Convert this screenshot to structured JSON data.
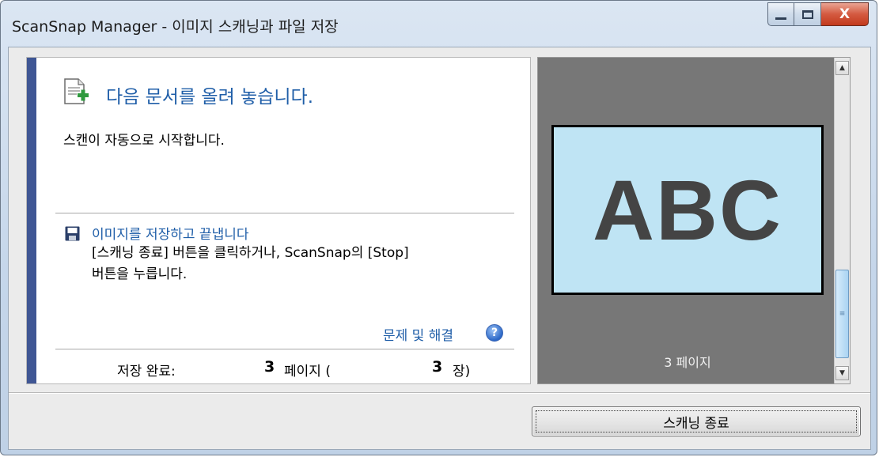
{
  "window": {
    "title": "ScanSnap Manager - 이미지 스캐닝과 파일 저장",
    "minimize_icon": "minimize-icon",
    "maximize_icon": "maximize-icon",
    "close_label": "X"
  },
  "main": {
    "heading": "다음 문서를 올려 놓습니다.",
    "subtitle": "스캔이 자동으로 시작합니다.",
    "save_link": "이미지를 저장하고 끝냅니다",
    "save_desc_line1": "[스캐닝 종료] 버튼을 클릭하거나, ScanSnap의 [Stop]",
    "save_desc_line2": "버튼을 누릅니다.",
    "help_link": "문제 및 해결",
    "help_icon_label": "?",
    "status": {
      "label": "저장 완료:",
      "pages_value": "3",
      "pages_unit": "페이지 (",
      "sheets_value": "3",
      "sheets_unit": "장)"
    }
  },
  "preview": {
    "page_text": "ABC",
    "page_label": "3 페이지",
    "scroll_up": "▲",
    "scroll_down": "▼",
    "scroll_grip": "≡",
    "accent_color": "#3f5694",
    "page_color": "#bfe4f4"
  },
  "footer": {
    "stop_button": "스캐닝 종료"
  }
}
